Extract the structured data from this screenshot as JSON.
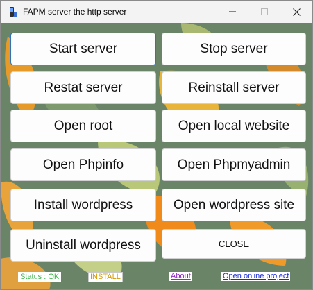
{
  "window": {
    "title": "FAPM server the http server"
  },
  "buttons": {
    "start_server": "Start server",
    "stop_server": "Stop server",
    "restart_server": "Restat server",
    "reinstall_server": "Reinstall server",
    "open_root": "Open root",
    "open_local_website": "Open local website",
    "open_phpinfo": "Open Phpinfo",
    "open_phpmyadmin": "Open Phpmyadmin",
    "install_wordpress": "Install wordpress",
    "open_wordpress_site": "Open wordpress site",
    "uninstall_wordpress": "Uninstall wordpress",
    "close": "CLOSE"
  },
  "statusbar": {
    "status": "Status :  OK",
    "install": "INSTALL",
    "about": "About",
    "open_project": "Open online project"
  },
  "colors": {
    "status_ok": "#3cb44b",
    "install": "#d99a00",
    "about": "#8e2cc4",
    "open_project": "#1a2bd8",
    "focus_border": "#2b73c9"
  }
}
